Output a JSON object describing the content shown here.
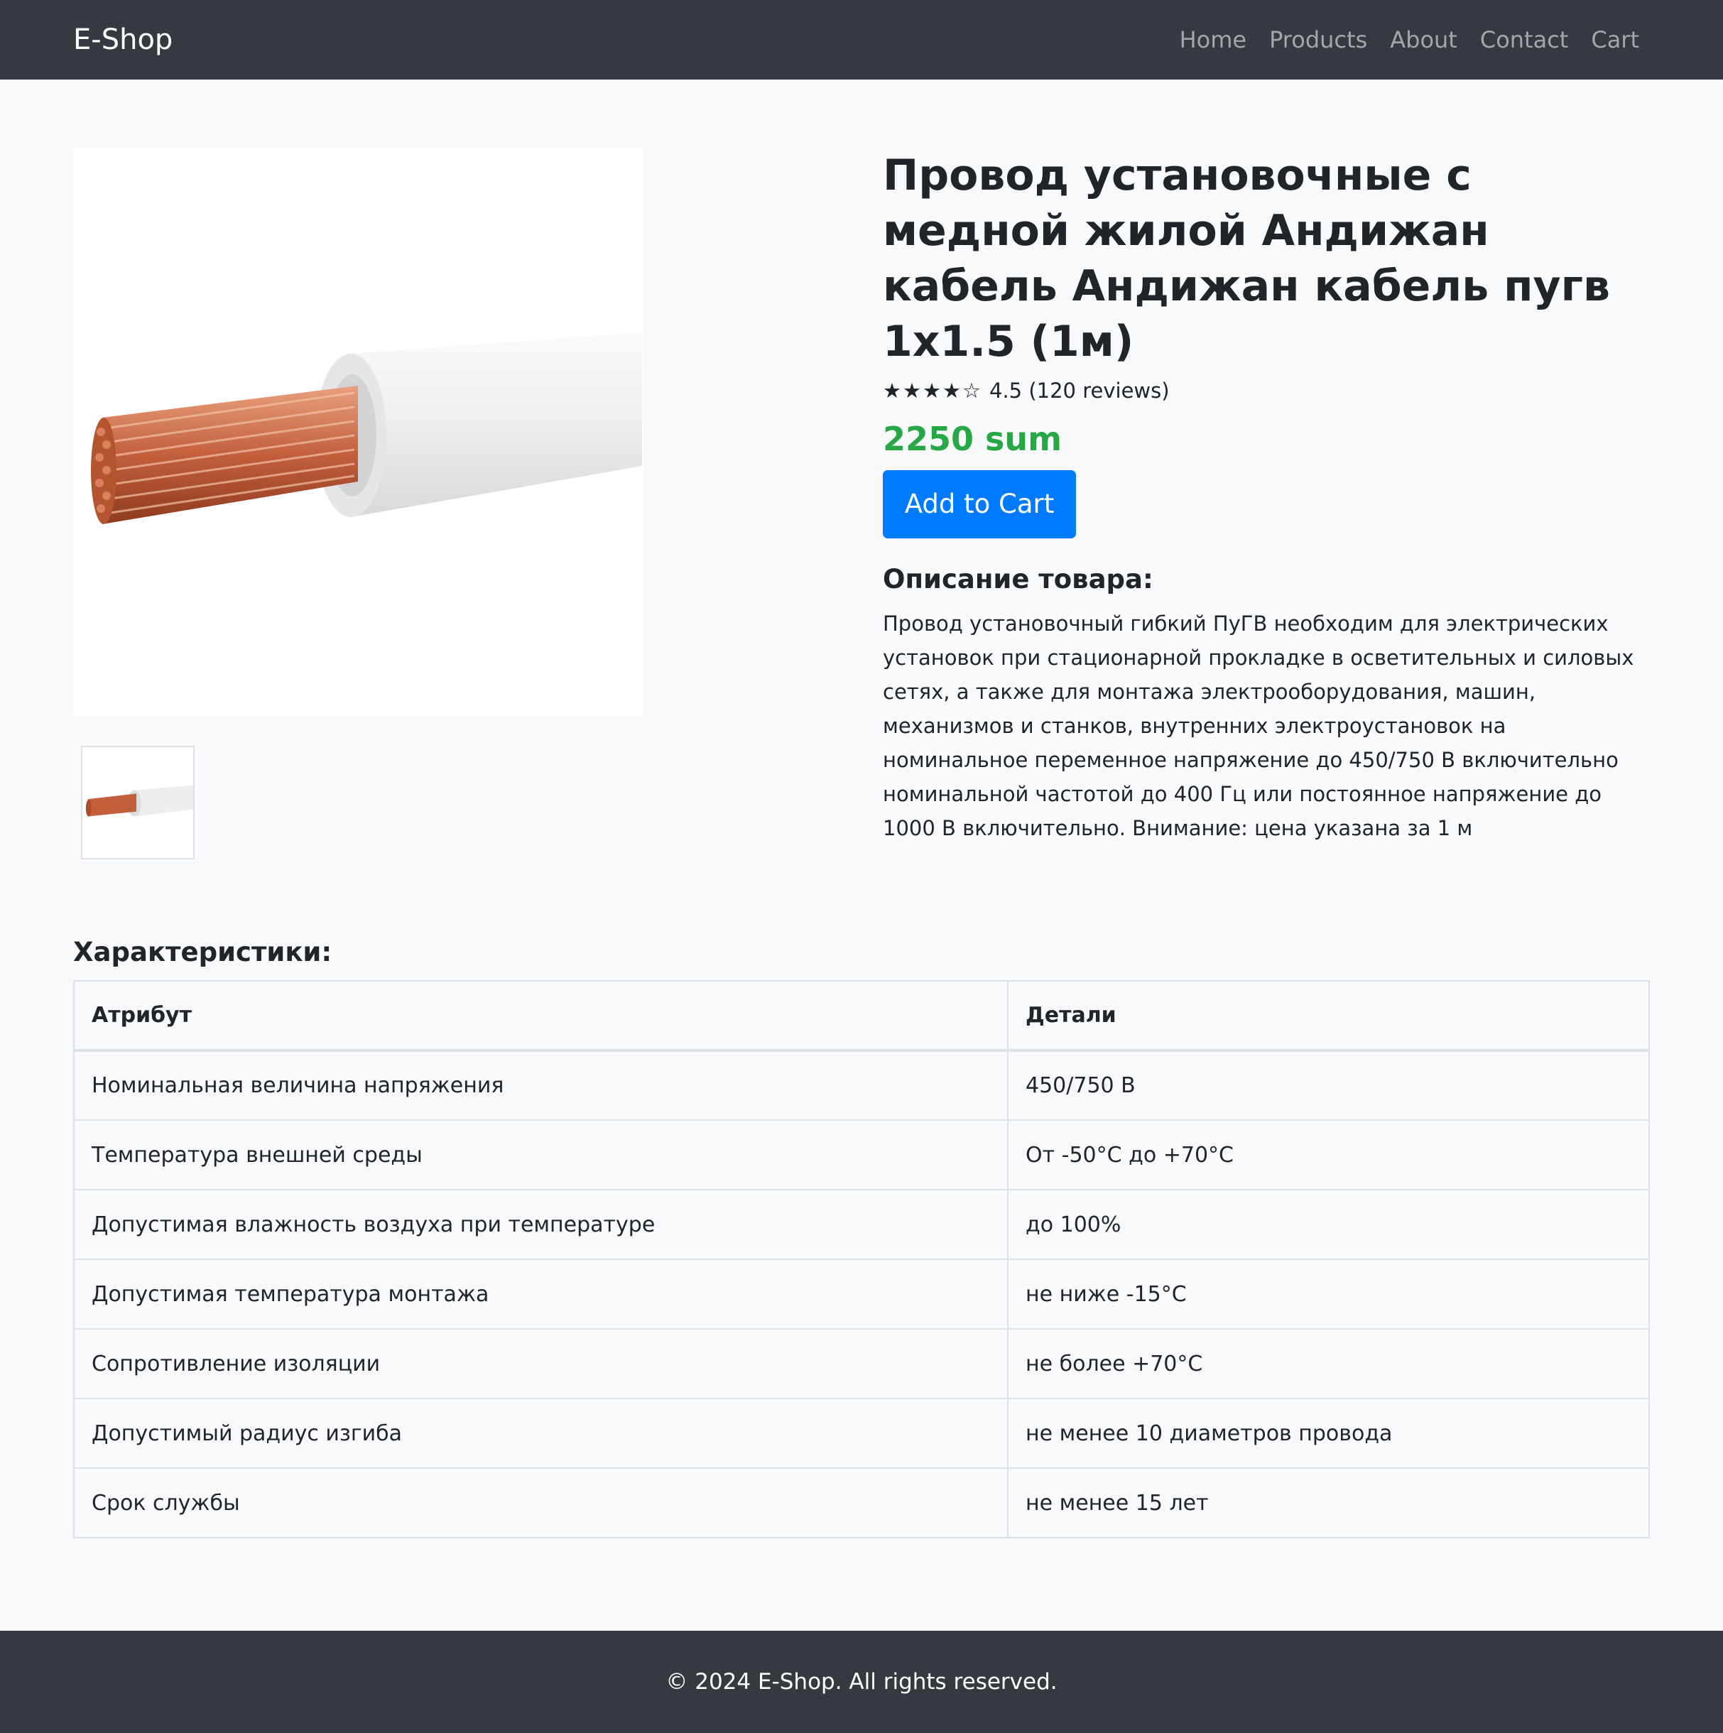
{
  "navbar": {
    "brand": "E-Shop",
    "links": [
      "Home",
      "Products",
      "About",
      "Contact",
      "Cart"
    ]
  },
  "product": {
    "image_icon": "copper-wire-cable-image",
    "title": "Провод установочные с медной жилой Андижан кабель Андижан кабель пугв 1x1.5 (1м)",
    "stars": "★★★★☆",
    "rating_text": "4.5 (120 reviews)",
    "rating_value": 4.5,
    "price": "2250 sum",
    "add_to_cart_label": "Add to Cart",
    "description_title": "Описание товара:",
    "description": "Провод установочный гибкий ПуГВ необходим для электрических установок при стационарной прокладке в осветительных и силовых сетях, а также для монтажа электрооборудования, машин, механизмов и станков, внутренних электроустановок на номинальное переменное напряжение до 450/750 В включительно номинальной частотой до 400 Гц или постоянное напряжение до 1000 В включительно. Внимание: цена указана за 1 м"
  },
  "specs": {
    "title": "Характеристики:",
    "headers": [
      "Атрибут",
      "Детали"
    ],
    "rows": [
      [
        "Номинальная величина напряжения",
        "450/750 В"
      ],
      [
        "Температура внешней среды",
        "От -50°С до +70°С"
      ],
      [
        "Допустимая влажность воздуха при температуре",
        "до 100%"
      ],
      [
        "Допустимая температура монтажа",
        "не ниже -15°С"
      ],
      [
        "Сопротивление изоляции",
        "не более +70°С"
      ],
      [
        "Допустимый радиус изгиба",
        "не менее 10 диаметров провода"
      ],
      [
        "Срок службы",
        "не менее 15 лет"
      ]
    ]
  },
  "footer": {
    "text": "© 2024 E-Shop. All rights reserved."
  },
  "colors": {
    "navbar_bg": "#343a40",
    "price": "#28a745",
    "button": "#007bff",
    "page_bg": "#f8f9fa"
  }
}
